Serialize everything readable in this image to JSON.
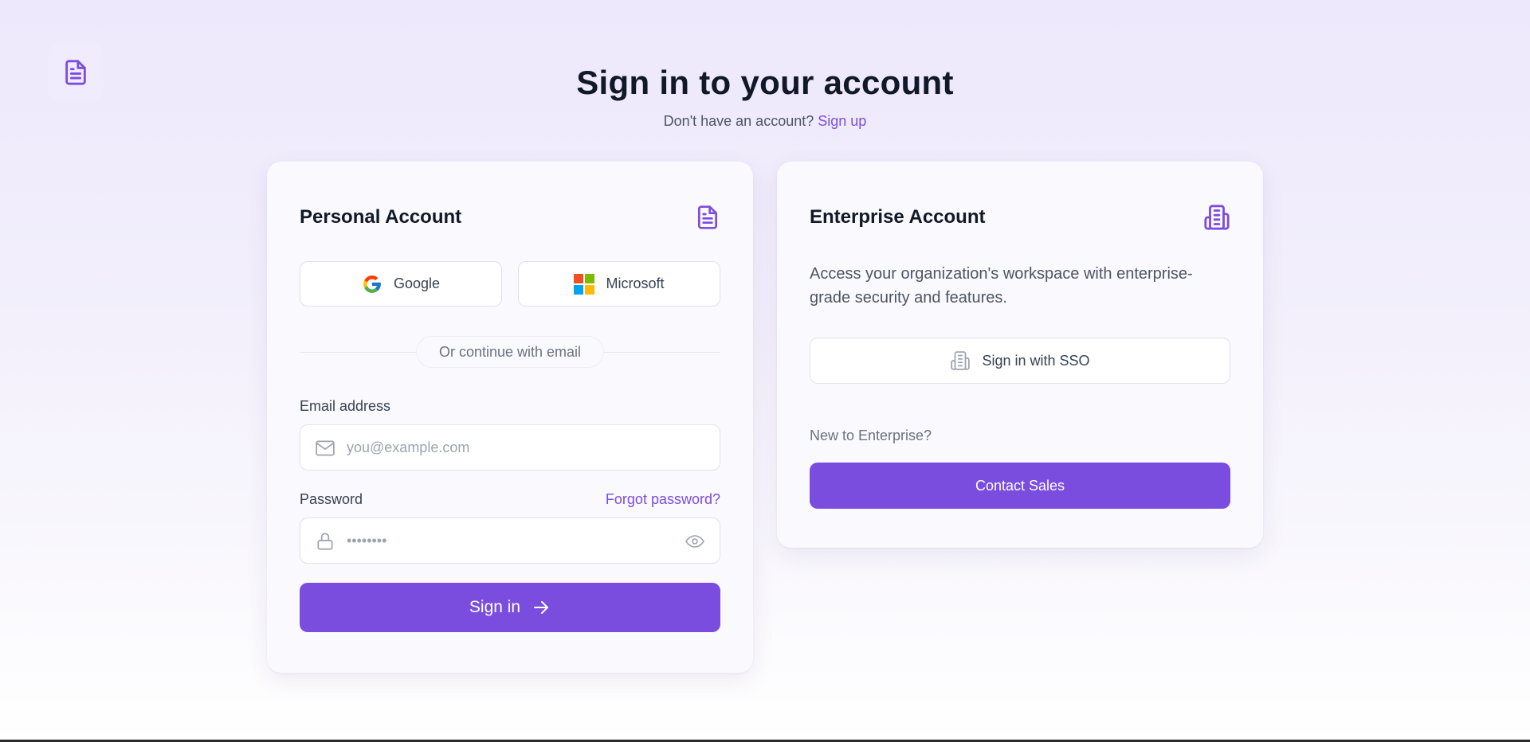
{
  "header": {
    "title": "Sign in to your account",
    "subtitle_text": "Don't have an account?",
    "signup_link": "Sign up"
  },
  "personal": {
    "title": "Personal Account",
    "google_label": "Google",
    "microsoft_label": "Microsoft",
    "divider_text": "Or continue with email",
    "email_label": "Email address",
    "email_placeholder": "you@example.com",
    "email_value": "",
    "password_label": "Password",
    "forgot_link": "Forgot password?",
    "password_placeholder": "••••••••",
    "password_value": "",
    "signin_label": "Sign in"
  },
  "enterprise": {
    "title": "Enterprise Account",
    "description": "Access your organization's workspace with enterprise-grade security and features.",
    "sso_label": "Sign in with SSO",
    "new_label": "New to Enterprise?",
    "contact_label": "Contact Sales"
  },
  "colors": {
    "accent": "#7b4ddf",
    "title": "#111827",
    "muted": "#6b7280"
  },
  "icons": {
    "logo": "document-icon",
    "personal": "document-icon",
    "enterprise": "building-icon",
    "email": "mail-icon",
    "password": "lock-icon",
    "show_password": "eye-icon",
    "signin": "arrow-right-icon"
  }
}
